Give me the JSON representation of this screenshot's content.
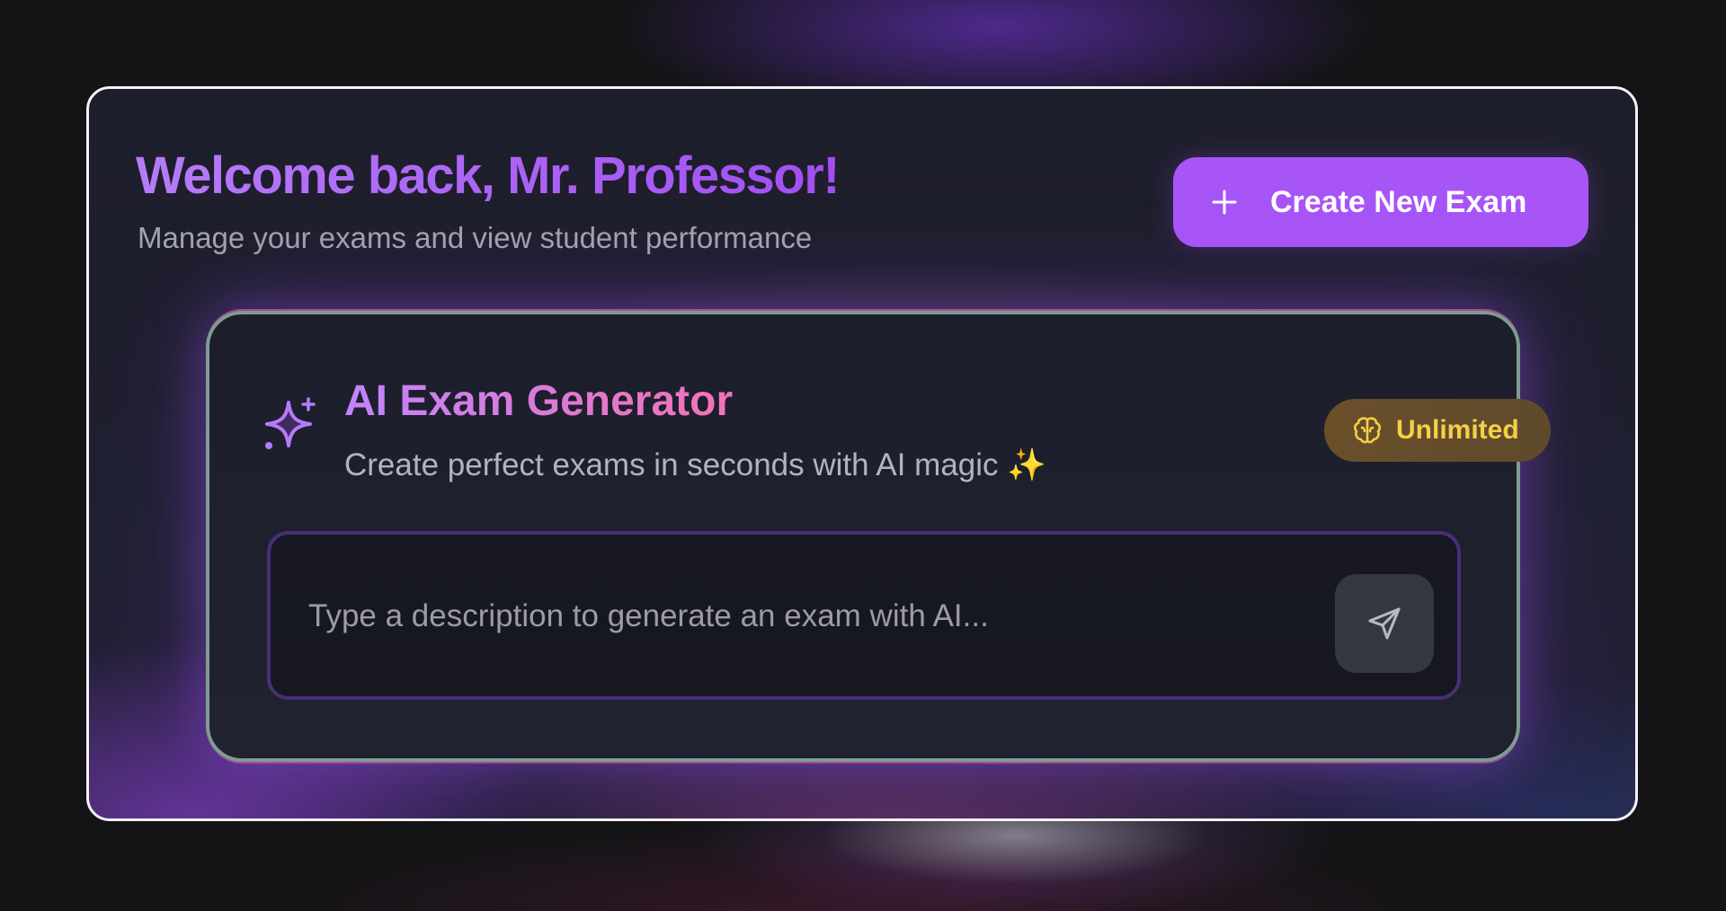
{
  "header": {
    "welcome_title": "Welcome back, Mr. Professor!",
    "welcome_subtitle": "Manage your exams and view student performance",
    "create_button_label": "Create New Exam",
    "create_button_icon": "plus-icon"
  },
  "ai_generator": {
    "icon": "sparkles-icon",
    "title": "AI Exam Generator",
    "subtitle": "Create perfect exams in seconds with AI magic",
    "subtitle_emoji": "✨",
    "badge_icon": "brain-icon",
    "badge_label": "Unlimited",
    "input_placeholder": "Type a description to generate an exam with AI...",
    "input_value": "",
    "send_icon": "send-icon"
  },
  "colors": {
    "accent_purple": "#a855f7",
    "title_gradient_start": "#c084fc",
    "title_gradient_end": "#f472b6",
    "badge_text": "#f6cf45",
    "badge_bg": "#6a4f2a",
    "card_border": "#7f9c93",
    "input_border": "#4a2e78"
  }
}
